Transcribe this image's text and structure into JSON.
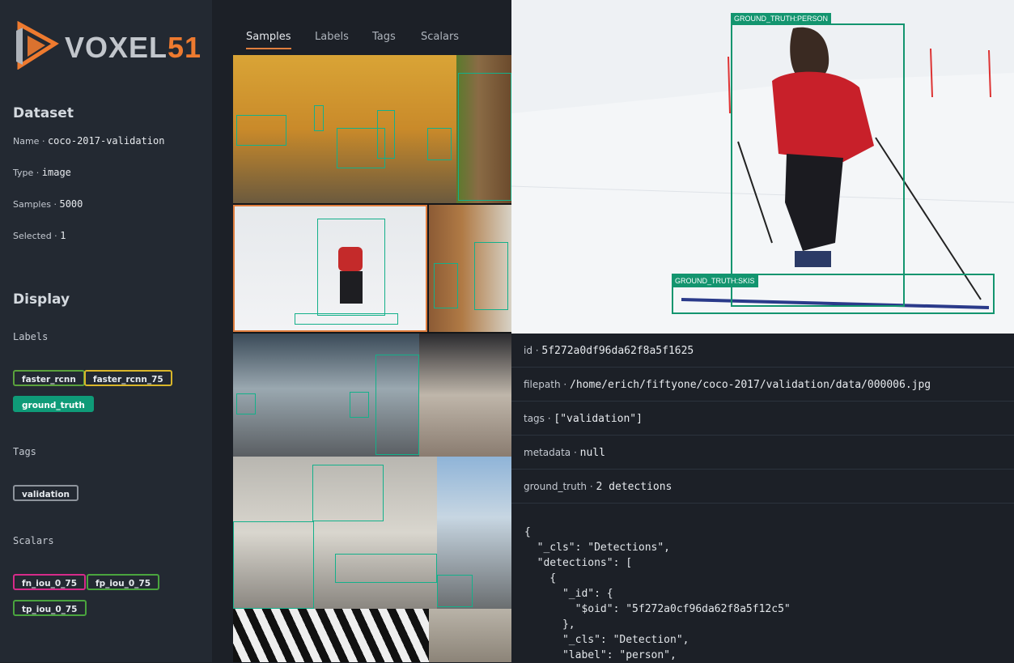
{
  "brand": {
    "name_a": "VOXEL",
    "name_b": "51"
  },
  "dataset": {
    "title": "Dataset",
    "name_label": "Name",
    "name": "coco-2017-validation",
    "type_label": "Type",
    "type": "image",
    "samples_label": "Samples",
    "samples": "5000",
    "selected_label": "Selected",
    "selected": "1"
  },
  "display": {
    "title": "Display",
    "labels_title": "Labels",
    "tags_title": "Tags",
    "scalars_title": "Scalars"
  },
  "chips": {
    "labels": [
      "faster_rcnn",
      "faster_rcnn_75",
      "ground_truth"
    ],
    "tags": [
      "validation"
    ],
    "scalars": [
      "fn_iou_0_75",
      "fp_iou_0_75",
      "tp_iou_0_75"
    ]
  },
  "tabs": [
    "Samples",
    "Labels",
    "Tags",
    "Scalars"
  ],
  "viewer": {
    "person_label": "GROUND_TRUTH:PERSON",
    "skis_label": "GROUND_TRUTH:SKIS"
  },
  "sample": {
    "id_label": "id",
    "id": "5f272a0df96da62f8a5f1625",
    "filepath_label": "filepath",
    "filepath": "/home/erich/fiftyone/coco-2017/validation/data/000006.jpg",
    "tags_label": "tags",
    "tags": "[\"validation\"]",
    "metadata_label": "metadata",
    "metadata": "null",
    "gt_label": "ground_truth",
    "gt": "2 detections",
    "json": "{\n  \"_cls\": \"Detections\",\n  \"detections\": [\n    {\n      \"_id\": {\n        \"$oid\": \"5f272a0cf96da62f8a5f12c5\"\n      },\n      \"_cls\": \"Detection\",\n      \"label\": \"person\","
  },
  "colors": {
    "accent": "#e07e3e",
    "detection": "#13956f",
    "sidebar": "#232932"
  }
}
